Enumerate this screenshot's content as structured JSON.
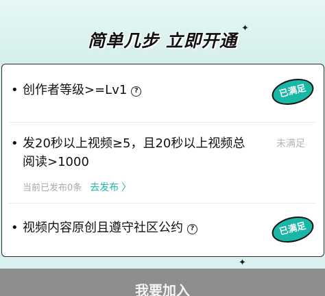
{
  "header": {
    "title": "简单几步 立即开通",
    "sparkle_icon": "sparkle-icon"
  },
  "requirements": [
    {
      "text": "创作者等级>=Lv1",
      "status": "已满足",
      "help_icon": "question-circle-icon"
    },
    {
      "text_line1": "发20秒以上视频≥5，且20秒以上视频总",
      "text_line2": "阅读>1000",
      "status": "未满足",
      "sub_text": "当前已发布0条",
      "action_label": "去发布",
      "action_icon": "chevron-right-icon"
    },
    {
      "text": "视频内容原创且遵守社区公约",
      "status": "已满足",
      "help_icon": "question-circle-icon"
    }
  ],
  "footer": {
    "join_button": "我要加入"
  },
  "colors": {
    "accent": "#19b7a6",
    "background": "#d8f1ee"
  }
}
